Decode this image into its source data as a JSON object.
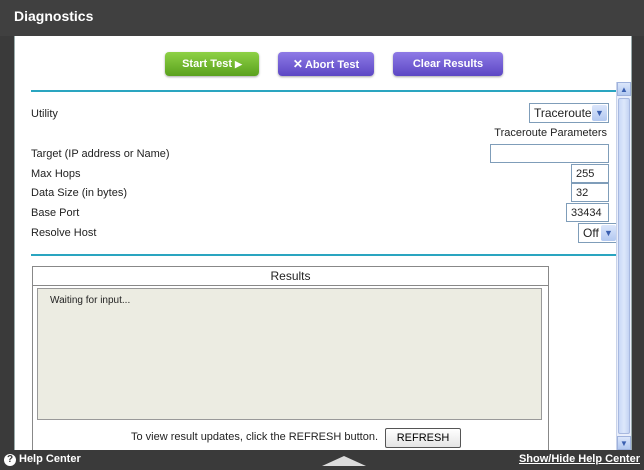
{
  "window": {
    "title": "Diagnostics"
  },
  "toolbar": {
    "start_label": "Start Test",
    "abort_label": "Abort Test",
    "clear_label": "Clear Results"
  },
  "form": {
    "utility_label": "Utility",
    "utility_value": "Traceroute",
    "params_heading": "Traceroute Parameters",
    "target_label": "Target (IP address or Name)",
    "target_value": "",
    "maxhops_label": "Max Hops",
    "maxhops_value": "255",
    "datasize_label": "Data Size (in bytes)",
    "datasize_value": "32",
    "baseport_label": "Base Port",
    "baseport_value": "33434",
    "resolve_label": "Resolve Host",
    "resolve_value": "Off"
  },
  "results": {
    "header": "Results",
    "text": "Waiting for input...",
    "refresh_text": "To view result updates, click the REFRESH button.",
    "refresh_button": "REFRESH"
  },
  "footer": {
    "help_center": "Help Center",
    "show_hide": "Show/Hide Help Center"
  },
  "icons": {
    "start": "play-icon",
    "abort": "x-icon",
    "help": "question-icon",
    "dropdown": "chevron-down-icon"
  }
}
